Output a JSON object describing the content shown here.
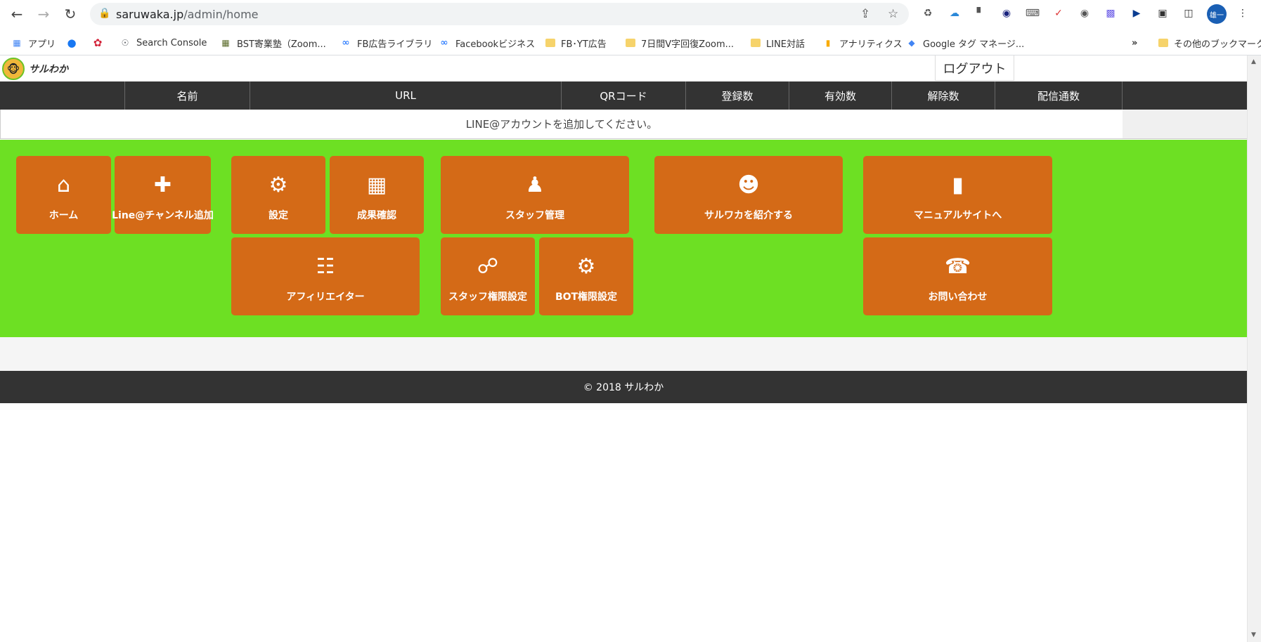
{
  "browser": {
    "url_domain": "saruwaka.jp",
    "url_path": "/admin/home",
    "profile_initials": "雄一"
  },
  "bookmarks": [
    {
      "label": "アプリ",
      "icon": "apps-grid-icon"
    },
    {
      "label": "",
      "icon": "facebook-icon"
    },
    {
      "label": "",
      "icon": "flower-icon"
    },
    {
      "label": "Search Console",
      "icon": "search-console-icon"
    },
    {
      "label": "BST寄業塾（Zoom...",
      "icon": "bst-icon"
    },
    {
      "label": "FB広告ライブラリ",
      "icon": "meta-icon"
    },
    {
      "label": "Facebookビジネス",
      "icon": "meta-icon"
    },
    {
      "label": "FB･YT広告",
      "icon": "folder-icon"
    },
    {
      "label": "7日間V字回復Zoom...",
      "icon": "folder-icon"
    },
    {
      "label": "LINE対話",
      "icon": "folder-icon"
    },
    {
      "label": "アナリティクス",
      "icon": "analytics-icon"
    },
    {
      "label": "Google タグ マネージ...",
      "icon": "tag-manager-icon"
    }
  ],
  "bookmarks_more": "»",
  "other_bookmarks": "その他のブックマーク",
  "header": {
    "logo_text": "サルわか",
    "logout_label": "ログアウト"
  },
  "table": {
    "columns": [
      "",
      "名前",
      "URL",
      "QRコード",
      "登録数",
      "有効数",
      "解除数",
      "配信通数",
      ""
    ],
    "empty_message": "LINE@アカウントを追加してください。"
  },
  "tiles": [
    {
      "label": "ホーム",
      "icon": "home-icon"
    },
    {
      "label": "Line@チャンネル追加",
      "icon": "add-user-icon"
    },
    {
      "label": "設定",
      "icon": "gears-icon"
    },
    {
      "label": "成果確認",
      "icon": "presentation-icon"
    },
    {
      "label": "スタッフ管理",
      "icon": "staff-group-icon"
    },
    {
      "label": "サルワカを紹介する",
      "icon": "monkey-icon"
    },
    {
      "label": "マニュアルサイトへ",
      "icon": "book-icon"
    },
    {
      "label": "アフィリエイター",
      "icon": "network-icon"
    },
    {
      "label": "スタッフ権限設定",
      "icon": "share-icon"
    },
    {
      "label": "BOT権限設定",
      "icon": "gear-badge-icon"
    },
    {
      "label": "お問い合わせ",
      "icon": "support-headset-icon"
    }
  ],
  "footer": {
    "copyright": "© 2018 サルわか"
  }
}
